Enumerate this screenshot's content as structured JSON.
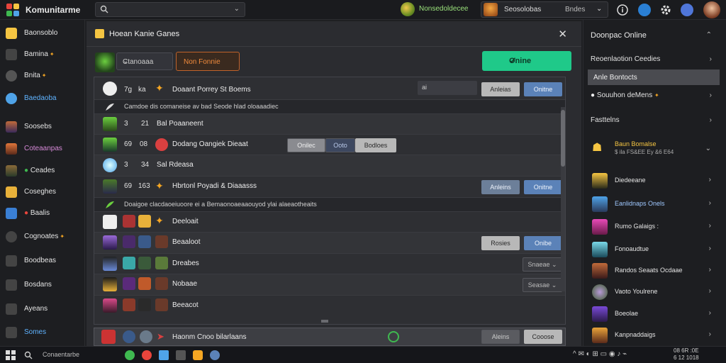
{
  "app": {
    "title": "Komunitarme"
  },
  "search": {
    "value": "",
    "placeholder": ""
  },
  "topbar": {
    "game_badge": "Nonsedoldecee",
    "user_name": "Seosolobas",
    "user_status": "Bndes"
  },
  "sidebar": {
    "items": [
      {
        "label": "Baonsoblo",
        "icon": "folder-icon",
        "color": "#f5c542"
      },
      {
        "label": "Bamina",
        "icon": "puzzle-icon",
        "star": "✦"
      },
      {
        "label": "Bnita",
        "icon": "user-icon",
        "star": "✦"
      },
      {
        "label": "Baedaoba",
        "icon": "globe-icon",
        "color": "#4fa3e8"
      },
      {
        "label": "Soosebs",
        "icon": "game-icon"
      },
      {
        "label": "Coteaanpas",
        "icon": "game2-icon"
      },
      {
        "label": "Ceades",
        "icon": "game3-icon"
      },
      {
        "label": "Coseghes",
        "icon": "folder2-icon"
      },
      {
        "label": "Baalis",
        "icon": "cloud-icon"
      },
      {
        "label": "Cognoates",
        "icon": "settings-icon",
        "star": "✦"
      },
      {
        "label": "Boodbeas",
        "icon": "pin-icon"
      },
      {
        "label": "Bosdans",
        "icon": "people-icon"
      },
      {
        "label": "Ayeans",
        "icon": "grid-icon"
      },
      {
        "label": "Somes",
        "icon": "music-icon"
      }
    ]
  },
  "panel": {
    "title": "Hoean Kanie Ganes",
    "filter_select": "Ctanoaaa",
    "filter_button": "Non Fonnie",
    "online_button": "Onine",
    "rows": [
      {
        "kind": "row",
        "num1": "7g",
        "num2": "ka",
        "name": "Doaant Porrey St Boems",
        "input": "ai",
        "btn1": "Anleias",
        "btn2": "Onitne"
      },
      {
        "kind": "group",
        "text": "Camdoe dis comaneise av bad Seode hlad oloaaadiec"
      },
      {
        "kind": "row",
        "num1": "3",
        "num2": "21",
        "name": "Bal Poaaneent"
      },
      {
        "kind": "row",
        "num1": "69",
        "num2": "08",
        "name": "Dodang Oangiek Dieaat",
        "btn_a": "Onilec",
        "btn_b": "Ooto",
        "btn_c": "Bodloes"
      },
      {
        "kind": "row",
        "num1": "3",
        "num2": "34",
        "name": "Sal Rdeasa"
      },
      {
        "kind": "row",
        "num1": "69",
        "num2": "163",
        "name": "Hbrtonl Poyadi & Diaaasss",
        "btn1": "Anleins",
        "btn2": "Onitne"
      },
      {
        "kind": "group",
        "text": "Doaigoe clacdaoeiuoore ei a Bemaonoaeaaouyod ylai alaeaotheaits"
      },
      {
        "kind": "row",
        "name": "Deeloait"
      },
      {
        "kind": "row",
        "name": "Beaaloot",
        "btn1": "Rosies",
        "btn2": "Onibe"
      },
      {
        "kind": "row",
        "name": "Dreabes",
        "dd": "Snaeae"
      },
      {
        "kind": "row",
        "name": "Nobaae",
        "dd": "Seasae"
      },
      {
        "kind": "row",
        "name": "Beeacot"
      }
    ],
    "bottom_row": {
      "name": "Haonm Cnoo bilarlaans",
      "btn1": "Aleins",
      "btn2": "Cooose"
    }
  },
  "right": {
    "header": "Doonpac Online",
    "recent": "Reoenlaotion Ceedies",
    "selected": "Anle Bontocts",
    "suggestions": "Souuhon deMens",
    "friends_header": "Fasttelns",
    "featured_name": "Baun Bomalse",
    "featured_meta": "$ ila FS&EE Ey &6 E64",
    "friends": [
      {
        "name": "Diedeeane"
      },
      {
        "name": "Eanlidnaps Onels"
      },
      {
        "name": "Rumo Galaigs :"
      },
      {
        "name": "Fonoaudtue"
      },
      {
        "name": "Randos Seaats Ocdaae"
      },
      {
        "name": "Vaoto Youlrene"
      },
      {
        "name": "Boeolae"
      },
      {
        "name": "Kanpnaddaigs"
      }
    ]
  },
  "taskbar": {
    "search": "Conaentarbe",
    "clock": "08 6R :0E\n6 12 1018"
  }
}
